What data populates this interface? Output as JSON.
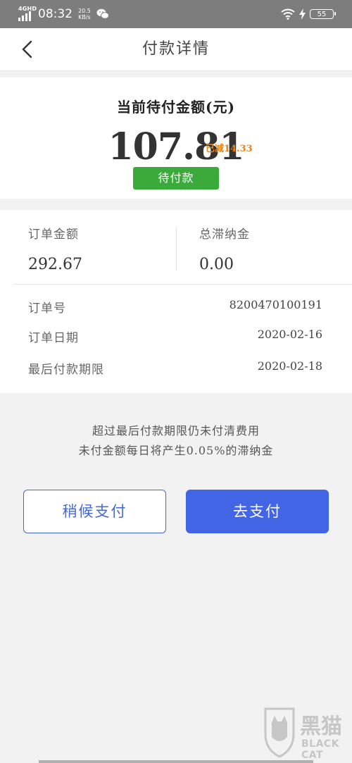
{
  "status_bar": {
    "network": "4GHD",
    "time": "08:32",
    "speed_value": "20.5",
    "speed_unit": "KB/s",
    "battery": "55"
  },
  "header": {
    "title": "付款详情"
  },
  "amount": {
    "label": "当前待付金额(元)",
    "value": "107.81",
    "reduced": "已减14.33",
    "status": "待付款"
  },
  "summary": {
    "order_amount_label": "订单金额",
    "order_amount_value": "292.67",
    "late_fee_label": "总滞纳金",
    "late_fee_value": "0.00"
  },
  "details": [
    {
      "label": "订单号",
      "value": "8200470100191"
    },
    {
      "label": "订单日期",
      "value": "2020-02-16"
    },
    {
      "label": "最后付款期限",
      "value": "2020-02-18"
    }
  ],
  "notice": {
    "line1": "超过最后付款期限仍未付清费用",
    "line2": "未付金额每日将产生0.05%的滞纳金"
  },
  "buttons": {
    "later": "稍候支付",
    "pay": "去支付"
  },
  "watermark": {
    "cn": "黑猫",
    "en": "BLACK CAT"
  },
  "colors": {
    "status_bar": "#7d7d7d",
    "badge_green": "#3aaa3a",
    "reduced_orange": "#e58418",
    "primary_blue": "#4265e6"
  }
}
